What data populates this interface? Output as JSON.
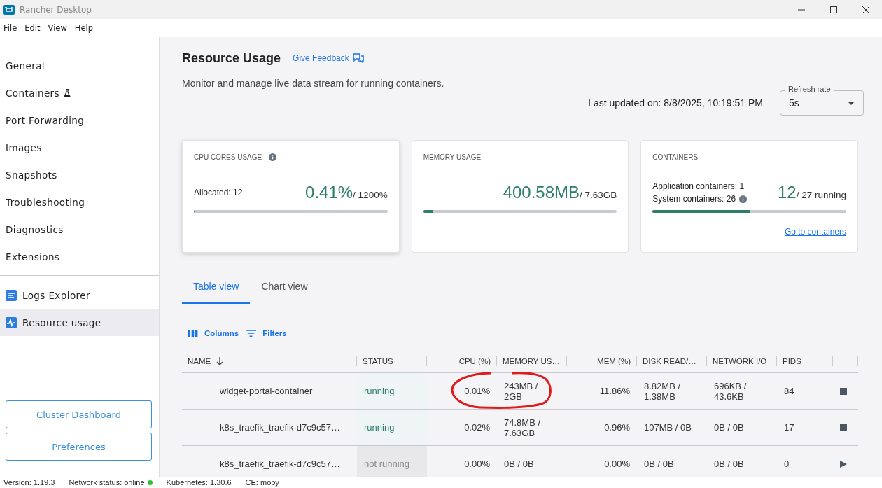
{
  "window": {
    "title": "Rancher Desktop"
  },
  "menu": [
    "File",
    "Edit",
    "View",
    "Help"
  ],
  "sidebar": {
    "items": [
      {
        "label": "General",
        "selected": false,
        "kind": "plain"
      },
      {
        "label": "Containers",
        "selected": false,
        "kind": "flask"
      },
      {
        "label": "Port Forwarding",
        "selected": false,
        "kind": "plain"
      },
      {
        "label": "Images",
        "selected": false,
        "kind": "plain"
      },
      {
        "label": "Snapshots",
        "selected": false,
        "kind": "plain"
      },
      {
        "label": "Troubleshooting",
        "selected": false,
        "kind": "plain"
      },
      {
        "label": "Diagnostics",
        "selected": false,
        "kind": "plain"
      },
      {
        "label": "Extensions",
        "selected": false,
        "kind": "plain"
      }
    ],
    "tools": [
      {
        "label": "Logs Explorer",
        "selected": false,
        "kind": "logs"
      },
      {
        "label": "Resource usage",
        "selected": true,
        "kind": "pulse"
      }
    ],
    "buttons": [
      "Cluster Dashboard",
      "Preferences"
    ]
  },
  "page": {
    "title": "Resource Usage",
    "feedback": "Give Feedback",
    "description": "Monitor and manage live data stream for running containers.",
    "last_updated": "Last updated on: 8/8/2025, 10:19:51 PM",
    "refresh": {
      "label": "Refresh rate",
      "value": "5s"
    }
  },
  "cards": [
    {
      "title": "CPU CORES USAGE",
      "info": true,
      "raised": true,
      "lines": [
        {
          "text": "Allocated: 12",
          "info": false
        }
      ],
      "big": "0.41%",
      "small": "/ 1200%",
      "level": 0.0034
    },
    {
      "title": "MEMORY USAGE",
      "info": false,
      "raised": false,
      "big": "400.58MB",
      "small": "/ 7.63GB",
      "level": 0.052
    },
    {
      "title": "CONTAINERS",
      "info": false,
      "raised": false,
      "lines": [
        {
          "text": "Application containers: 1",
          "info": false
        },
        {
          "text": "System containers: 26",
          "info": true
        }
      ],
      "big": "12",
      "small": "/ 27 running",
      "level": 0.5,
      "link": "Go to containers"
    }
  ],
  "tabs": [
    {
      "label": "Table view",
      "selected": true
    },
    {
      "label": "Chart view",
      "selected": false
    }
  ],
  "toolbar": [
    "Columns",
    "Filters"
  ],
  "table": {
    "columns": [
      "NAME",
      "STATUS",
      "CPU (%)",
      "MEMORY US…",
      "MEM (%)",
      "DISK READ/…",
      "NETWORK I/O",
      "PIDS"
    ],
    "rows": [
      {
        "name": "widget-portal-container",
        "status": "running",
        "running": true,
        "cpu": "0.01%",
        "memory": "243MB / 2GB",
        "mem": "11.86%",
        "disk": "8.82MB / 1.38MB",
        "network": "696KB / 43.6KB",
        "pids": "84",
        "circled": true
      },
      {
        "name": "k8s_traefik_traefik-d7c9c57…",
        "status": "running",
        "running": true,
        "cpu": "0.02%",
        "memory": "74.8MB / 7.63GB",
        "mem": "0.96%",
        "disk": "107MB / 0B",
        "network": "0B / 0B",
        "pids": "17",
        "circled": false
      },
      {
        "name": "k8s_traefik_traefik-d7c9c57…",
        "status": "not running",
        "running": false,
        "cpu": "0.00%",
        "memory": "0B / 0B",
        "mem": "0.00%",
        "disk": "0B / 0B",
        "network": "0B / 0B",
        "pids": "0",
        "circled": false
      }
    ]
  },
  "status_bar": [
    {
      "text": "Version: 1.19.3",
      "dot": false
    },
    {
      "text": "Network status: online",
      "dot": true
    },
    {
      "text": "Kubernetes: 1.30.6",
      "dot": false
    },
    {
      "text": "CE: moby",
      "dot": false
    }
  ]
}
